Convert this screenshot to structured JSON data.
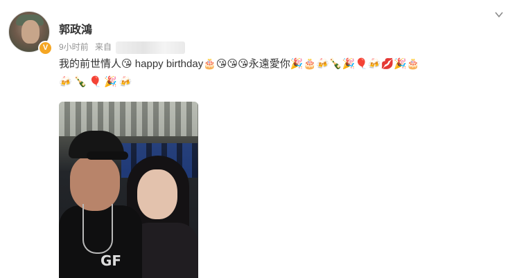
{
  "post": {
    "username": "郭政鴻",
    "time": "9小时前",
    "source_prefix": "来自",
    "text_line1": "我的前世情人😘 happy birthday🎂😘😘😘永遠愛你🎉🎂🍻🍾🎉🎈🍻💋🎉🎂",
    "text_line2": "🍻🍾🎈🎉🍻",
    "shirt_text": "GF",
    "verified_mark": "V"
  },
  "icons": {
    "more": "chevron-down-icon",
    "verified": "verified-badge-icon"
  },
  "colors": {
    "verified": "#f5a623",
    "meta": "#939393",
    "text": "#333333"
  }
}
